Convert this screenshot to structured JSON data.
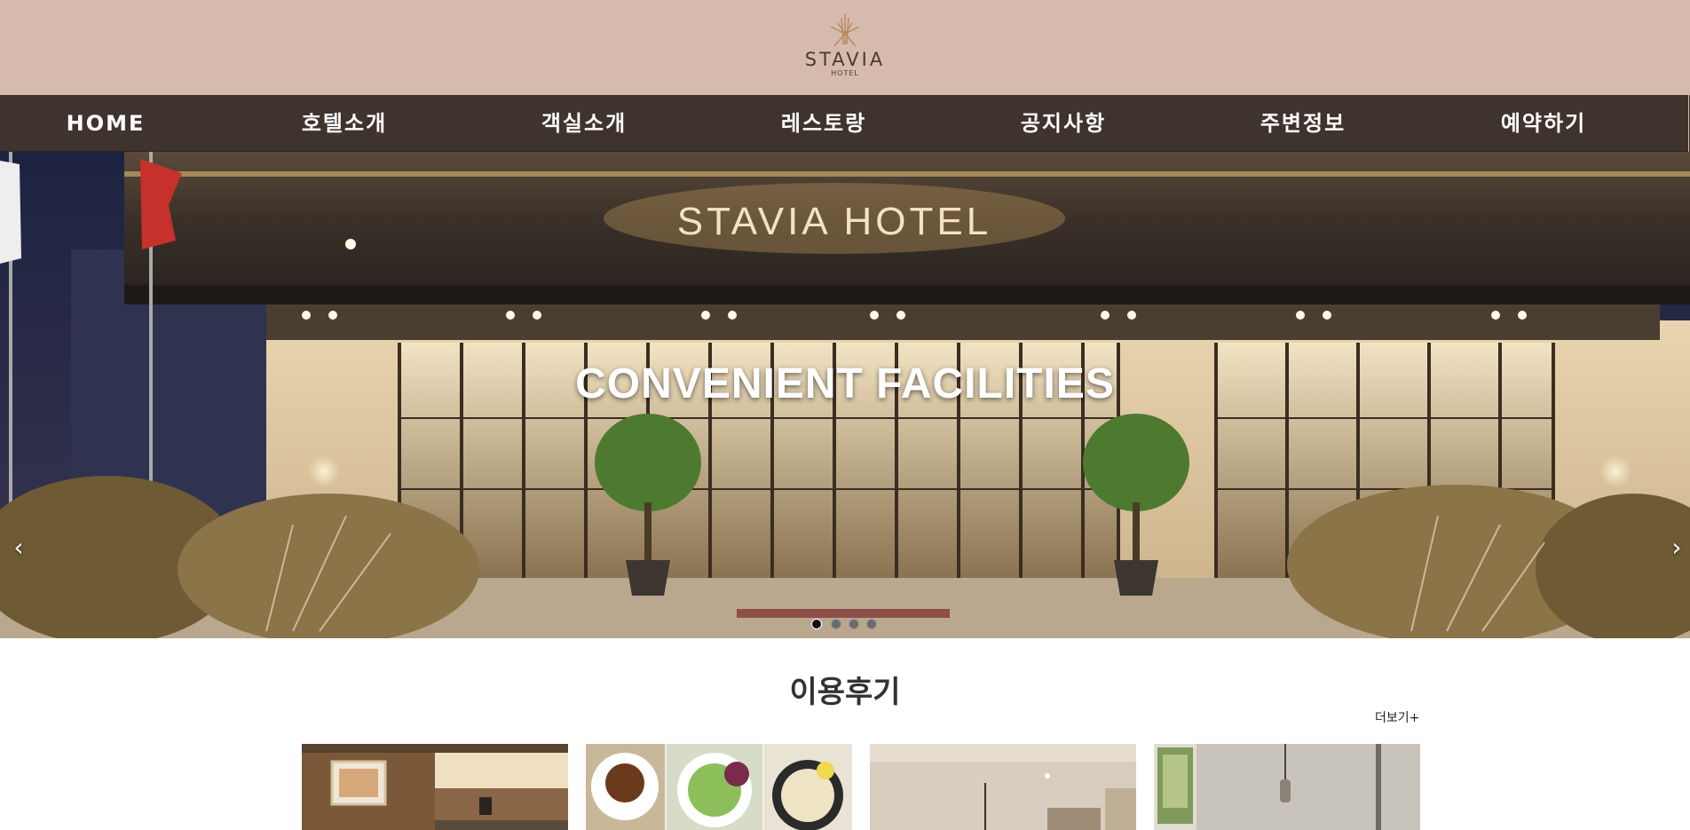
{
  "brand": {
    "name": "STAVIA",
    "sub": "HOTEL"
  },
  "nav": {
    "items": [
      {
        "label": "HOME"
      },
      {
        "label": "호텔소개"
      },
      {
        "label": "객실소개"
      },
      {
        "label": "레스토랑"
      },
      {
        "label": "공지사항"
      },
      {
        "label": "주변정보"
      },
      {
        "label": "예약하기"
      }
    ]
  },
  "hero": {
    "caption": "CONVENIENT FACILITIES",
    "sign_text": "STAVIA HOTEL",
    "prev_arrow": "‹",
    "next_arrow": "›",
    "slide_count": 4,
    "active_slide": 1
  },
  "reviews": {
    "title": "이용후기",
    "more_label": "더보기+"
  },
  "colors": {
    "header_bg": "#d6bbad",
    "nav_bg": "#3f332d",
    "text_dark": "#333333"
  },
  "icons": {
    "prev": "chevron-left-icon",
    "next": "chevron-right-icon",
    "logo": "star-logo-icon"
  }
}
